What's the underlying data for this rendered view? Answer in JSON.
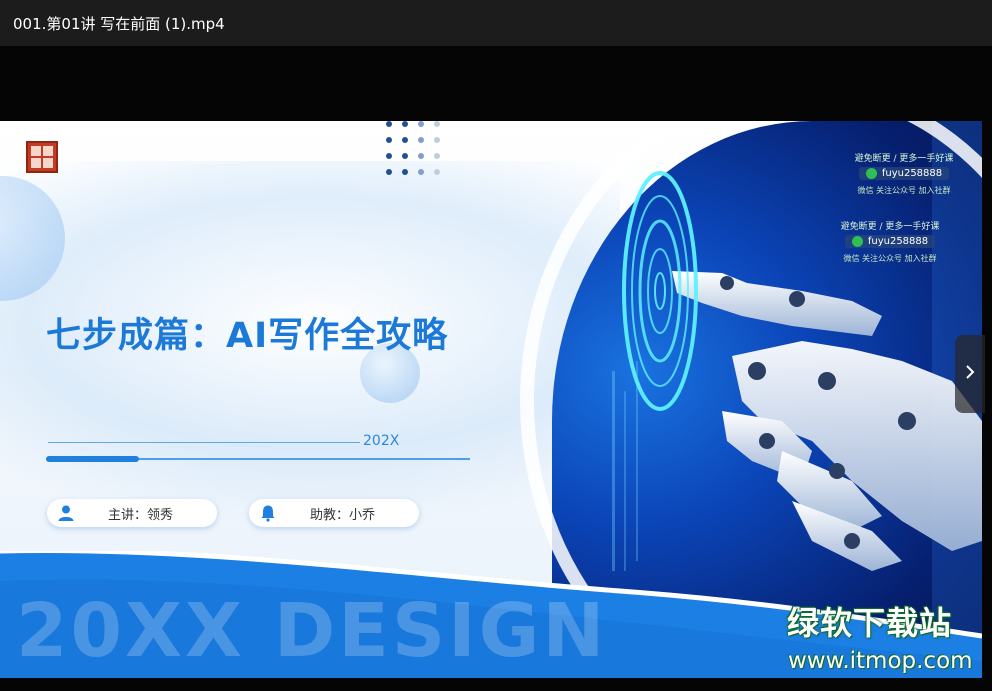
{
  "window": {
    "title": "001.第01讲 写在前面 (1).mp4"
  },
  "slide": {
    "main_title": "七步成篇：AI写作全攻略",
    "year": "202X",
    "progress_fraction": 0.22,
    "lecturer_label": "主讲：领秀",
    "assistant_label": "助教：小乔",
    "design_text": "20XX DESIGN",
    "colors": {
      "accent": "#1c79d8",
      "dark_blue": "#0b45b8",
      "dot_dark": "#1f4f9a",
      "dot_light": "#a9bdd8"
    }
  },
  "watermark": {
    "line1": "避免断更 / 更多一手好课",
    "id": "fuyu258888",
    "sub": "微信 关注公众号 加入社群",
    "line1_b": "避免断更 / 更多一手好课",
    "id_b": "fuyu258888",
    "sub_b": "微信 关注公众号 加入社群"
  },
  "site": {
    "logo_text": "绿软下载站",
    "url": "www.itmop.com"
  },
  "icons": {
    "lecturer": "person-icon",
    "assistant": "bell-icon",
    "next": "chevron-right-icon"
  }
}
